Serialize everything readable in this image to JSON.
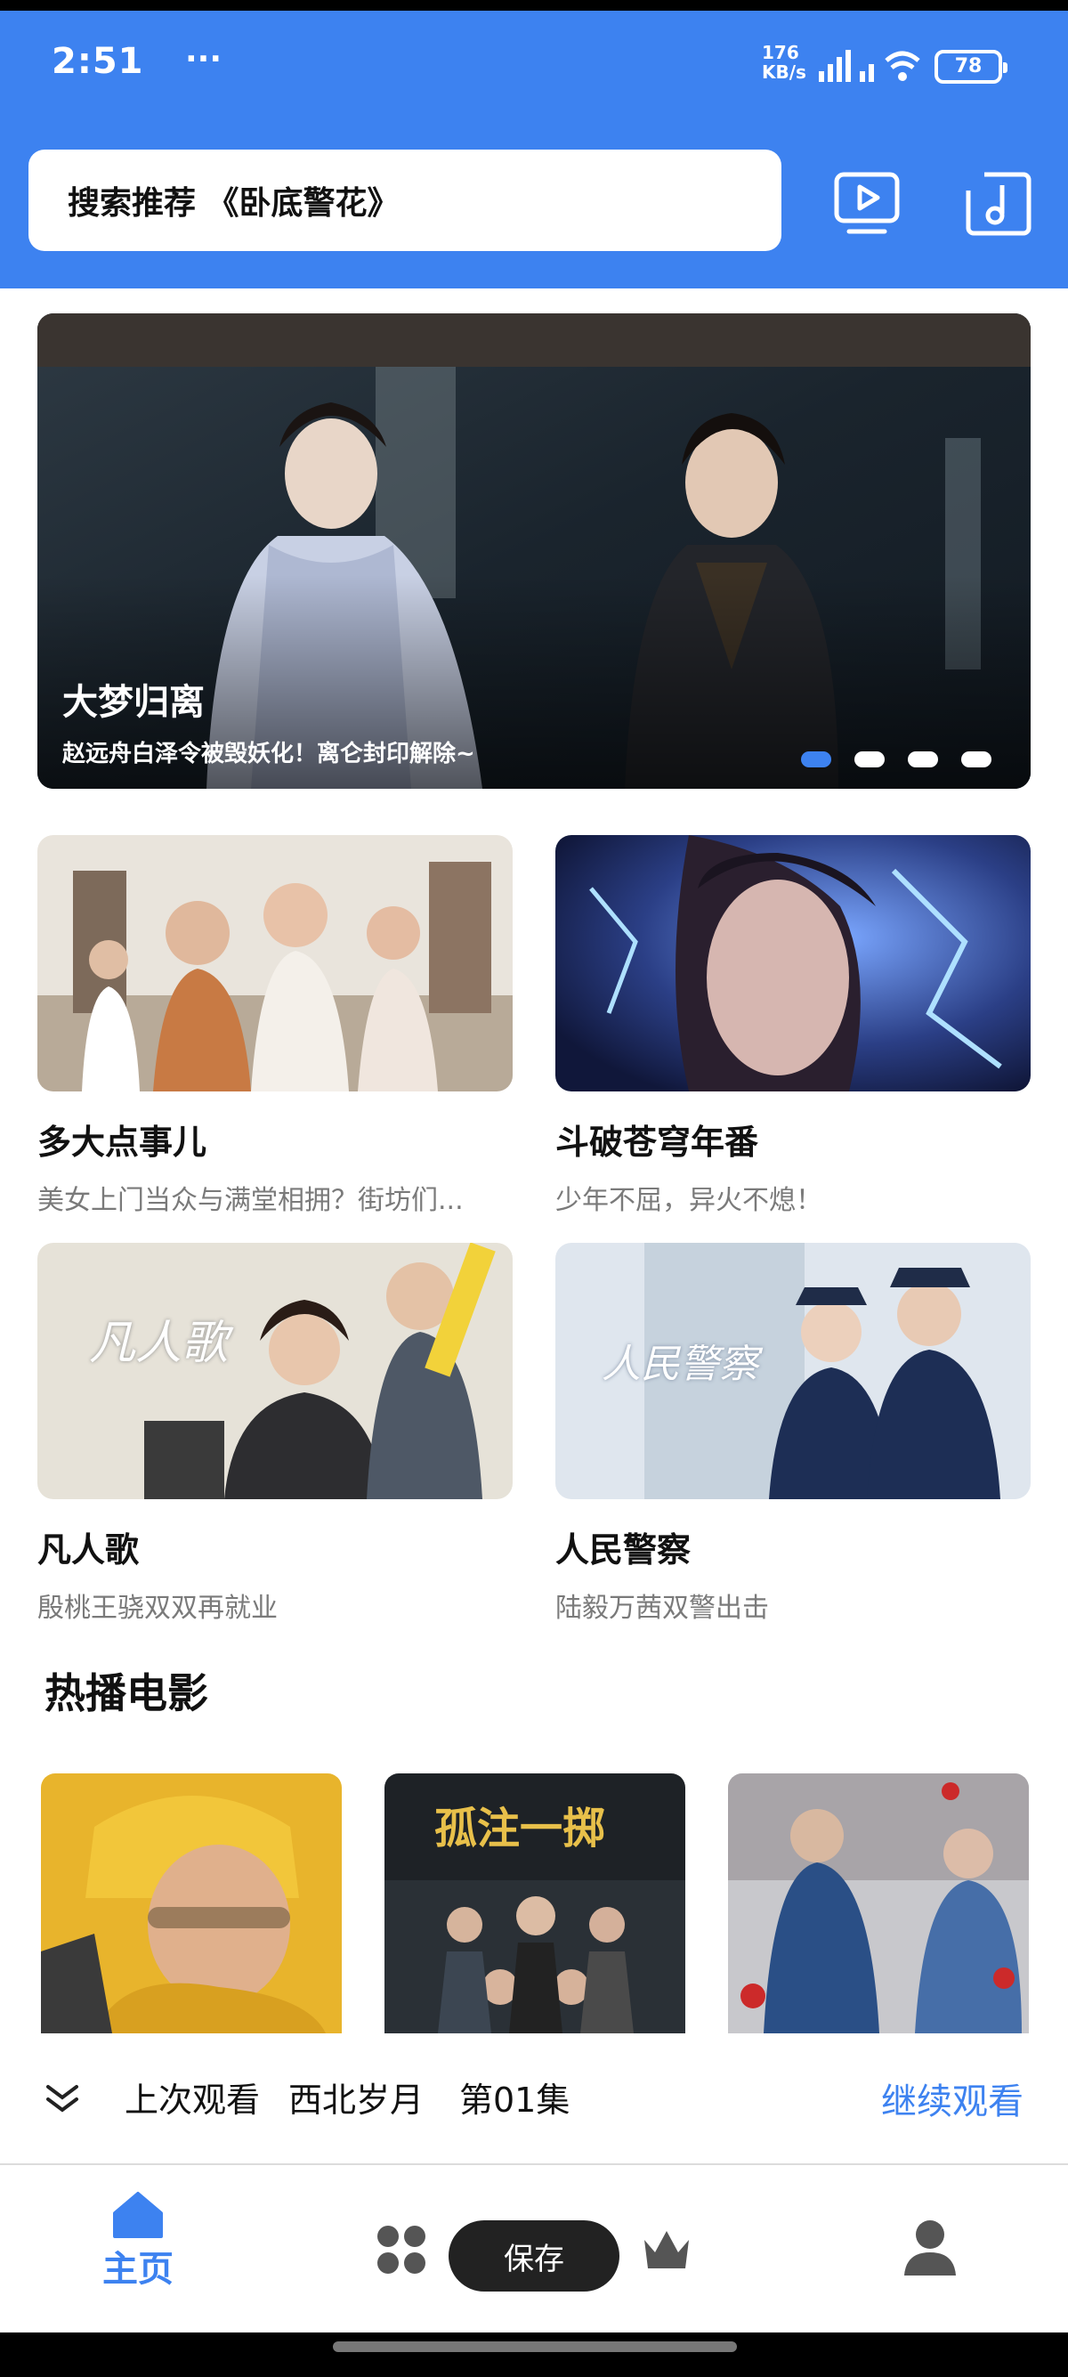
{
  "status_bar": {
    "time": "2:51",
    "dots": "···",
    "net_speed_value": "176",
    "net_speed_unit": "KB/s",
    "battery": "78"
  },
  "search": {
    "placeholder": "搜索推荐 《卧底警花》"
  },
  "header_icons": [
    "tv-play-icon",
    "music-note-icon"
  ],
  "banner": {
    "title": "大梦归离",
    "subtitle": "赵远舟白泽令被毁妖化！离仑封印解除~",
    "page_count": 4,
    "active_page": 1
  },
  "cards": [
    {
      "title": "多大点事儿",
      "subtitle": "美女上门当众与满堂相拥？街坊们..."
    },
    {
      "title": "斗破苍穹年番",
      "subtitle": "少年不屈，异火不熄！"
    },
    {
      "title": "凡人歌",
      "subtitle": "殷桃王骁双双再就业",
      "poster_text": "凡人歌"
    },
    {
      "title": "人民警察",
      "subtitle": "陆毅万茜双警出击",
      "poster_text": "人民警察"
    }
  ],
  "movies_section": {
    "title": "热播电影",
    "posters": [
      {
        "poster_text": ""
      },
      {
        "poster_text": "孤注一掷"
      },
      {
        "poster_text": ""
      }
    ]
  },
  "resume": {
    "label": "上次观看",
    "show": "西北岁月",
    "episode": "第01集",
    "action": "继续观看"
  },
  "tabbar": {
    "home_label": "主页",
    "save_label": "保存",
    "tabs": [
      "home-icon",
      "apps-icon",
      "crown-icon",
      "user-icon"
    ],
    "active": "home"
  },
  "colors": {
    "brand": "#3d82f0",
    "text": "#111111",
    "muted": "#7a7a7a"
  }
}
